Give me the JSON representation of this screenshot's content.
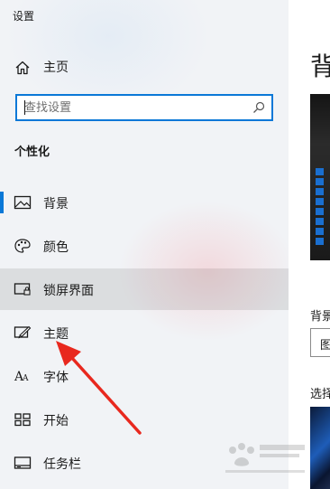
{
  "window": {
    "title": "设置"
  },
  "sidebar": {
    "home": {
      "label": "主页",
      "icon": "home-icon"
    },
    "search": {
      "placeholder": "查找设置",
      "value": "",
      "icon": "search-icon"
    },
    "section_title": "个性化",
    "items": [
      {
        "label": "背景",
        "icon": "picture-icon",
        "selected": true
      },
      {
        "label": "颜色",
        "icon": "palette-icon"
      },
      {
        "label": "锁屏界面",
        "icon": "lock-screen-icon",
        "hovered": true
      },
      {
        "label": "主题",
        "icon": "theme-brush-icon"
      },
      {
        "label": "字体",
        "icon": "font-icon"
      },
      {
        "label": "开始",
        "icon": "start-grid-icon"
      },
      {
        "label": "任务栏",
        "icon": "taskbar-icon"
      }
    ]
  },
  "content": {
    "title": "背",
    "background_label": "背景",
    "background_select_value": "图",
    "choose_picture_label": "选择"
  },
  "annotation": {
    "type": "red-arrow",
    "color": "#e8281e"
  },
  "colors": {
    "accent": "#0a78d7",
    "sidebar_bg": "#f1f3f6",
    "hover_bg": "#e3e4e6"
  }
}
